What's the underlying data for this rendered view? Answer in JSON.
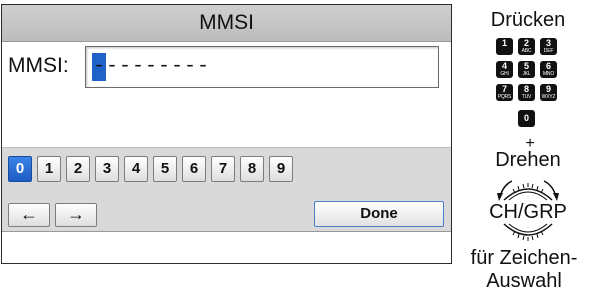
{
  "screen": {
    "title": "MMSI",
    "field_label": "MMSI:",
    "field_value": "---------",
    "digits": [
      "0",
      "1",
      "2",
      "3",
      "4",
      "5",
      "6",
      "7",
      "8",
      "9"
    ],
    "selected_digit": "0",
    "left_arrow": "←",
    "right_arrow": "→",
    "done_label": "Done"
  },
  "instructions": {
    "press": "Drücken",
    "keys": [
      {
        "n": "1",
        "l": ""
      },
      {
        "n": "2",
        "l": "ABC"
      },
      {
        "n": "3",
        "l": "DEF"
      },
      {
        "n": "4",
        "l": "GHI"
      },
      {
        "n": "5",
        "l": "JKL"
      },
      {
        "n": "6",
        "l": "MNO"
      },
      {
        "n": "7",
        "l": "PQRS"
      },
      {
        "n": "8",
        "l": "TUV"
      },
      {
        "n": "9",
        "l": "WXYZ"
      },
      {
        "n": "0",
        "l": ""
      }
    ],
    "plus": "+",
    "turn": "Drehen",
    "dial_label": "CH/GRP",
    "for_chars": "für Zeichen-",
    "selection": "Auswahl"
  },
  "colors": {
    "selection_blue": "#1f63c9",
    "key_black": "#111111",
    "bar_gray": "#d9d9d9"
  }
}
